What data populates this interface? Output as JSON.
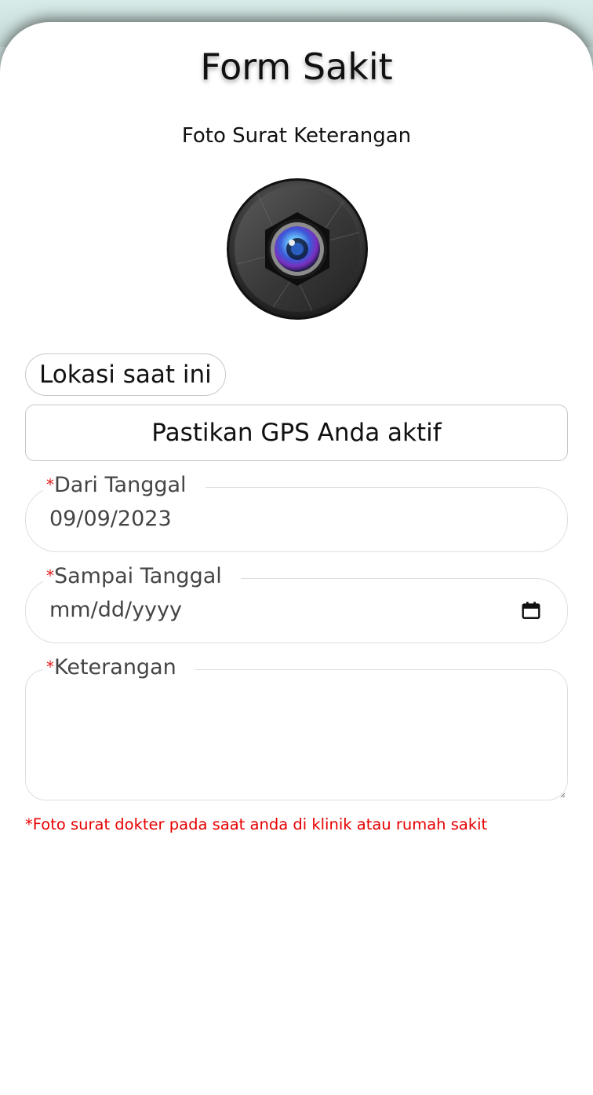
{
  "page": {
    "title": "Form Sakit",
    "photo_label": "Foto Surat Keterangan"
  },
  "camera": {
    "icon": "camera-lens-icon"
  },
  "location": {
    "button_label": "Lokasi saat ini",
    "gps_message": "Pastikan GPS Anda aktif"
  },
  "form": {
    "required_mark": "*",
    "from_date": {
      "label": "Dari Tanggal",
      "value": "09/09/2023"
    },
    "to_date": {
      "label": "Sampai Tanggal",
      "placeholder": "mm/dd/yyyy",
      "icon": "calendar-icon"
    },
    "notes": {
      "label": "Keterangan",
      "value": ""
    },
    "footnote": "*Foto surat dokter pada saat anda di klinik atau rumah sakit"
  },
  "colors": {
    "required": "#e01b1b",
    "footnote": "#e60000",
    "border": "#c8c8c8",
    "background_tint": "#d9ecea"
  }
}
